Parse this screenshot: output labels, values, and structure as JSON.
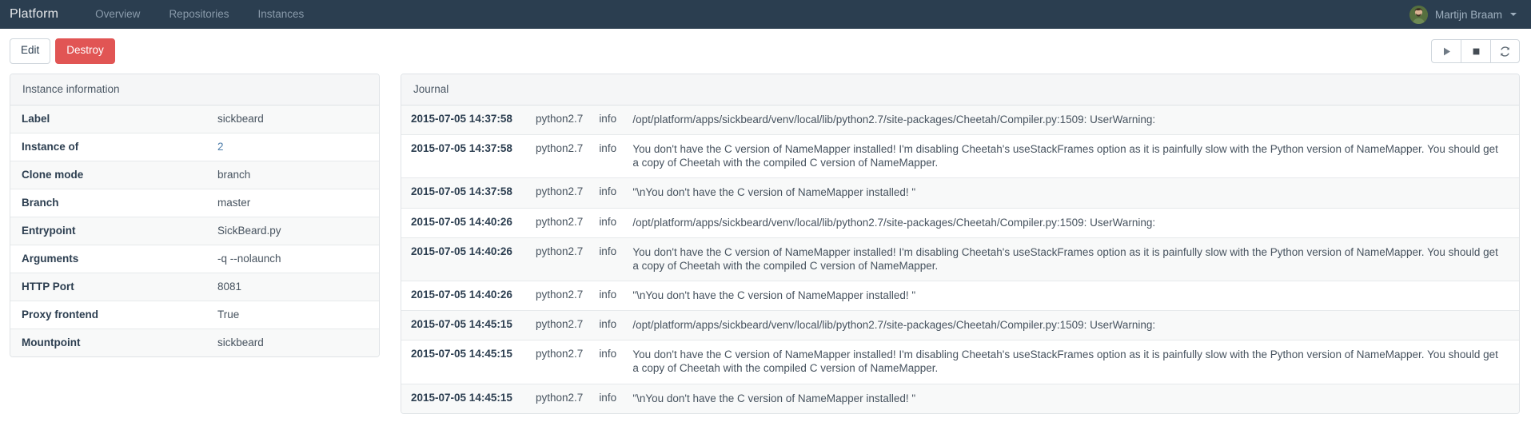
{
  "navbar": {
    "brand": "Platform",
    "links": [
      {
        "label": "Overview"
      },
      {
        "label": "Repositories"
      },
      {
        "label": "Instances"
      }
    ],
    "user": {
      "name": "Martijn Braam",
      "avatar_icon": "user-avatar-photo",
      "caret_icon": "caret-down-icon"
    },
    "background_color": "#2b3e50"
  },
  "toolbar": {
    "edit_label": "Edit",
    "destroy_label": "Destroy",
    "destroy_color": "#e15554",
    "actions": [
      {
        "icon": "play-icon",
        "title": "Start"
      },
      {
        "icon": "stop-icon",
        "title": "Stop"
      },
      {
        "icon": "refresh-icon",
        "title": "Restart"
      }
    ]
  },
  "instance_panel": {
    "title": "Instance information",
    "rows": [
      {
        "key": "Label",
        "value": "sickbeard",
        "link": false
      },
      {
        "key": "Instance of",
        "value": "2",
        "link": true
      },
      {
        "key": "Clone mode",
        "value": "branch",
        "link": false
      },
      {
        "key": "Branch",
        "value": "master",
        "link": false
      },
      {
        "key": "Entrypoint",
        "value": "SickBeard.py",
        "link": false
      },
      {
        "key": "Arguments",
        "value": "-q --nolaunch",
        "link": false
      },
      {
        "key": "HTTP Port",
        "value": "8081",
        "link": false
      },
      {
        "key": "Proxy frontend",
        "value": "True",
        "link": false
      },
      {
        "key": "Mountpoint",
        "value": "sickbeard",
        "link": false
      }
    ]
  },
  "journal_panel": {
    "title": "Journal",
    "entries": [
      {
        "timestamp": "2015-07-05 14:37:58",
        "source": "python2.7",
        "level": "info",
        "message": "/opt/platform/apps/sickbeard/venv/local/lib/python2.7/site-packages/Cheetah/Compiler.py:1509: UserWarning:"
      },
      {
        "timestamp": "2015-07-05 14:37:58",
        "source": "python2.7",
        "level": "info",
        "message": "You don't have the C version of NameMapper installed! I'm disabling Cheetah's useStackFrames option as it is painfully slow with the Python version of NameMapper. You should get a copy of Cheetah with the compiled C version of NameMapper."
      },
      {
        "timestamp": "2015-07-05 14:37:58",
        "source": "python2.7",
        "level": "info",
        "message": "\"\\nYou don't have the C version of NameMapper installed! \""
      },
      {
        "timestamp": "2015-07-05 14:40:26",
        "source": "python2.7",
        "level": "info",
        "message": "/opt/platform/apps/sickbeard/venv/local/lib/python2.7/site-packages/Cheetah/Compiler.py:1509: UserWarning:"
      },
      {
        "timestamp": "2015-07-05 14:40:26",
        "source": "python2.7",
        "level": "info",
        "message": "You don't have the C version of NameMapper installed! I'm disabling Cheetah's useStackFrames option as it is painfully slow with the Python version of NameMapper. You should get a copy of Cheetah with the compiled C version of NameMapper."
      },
      {
        "timestamp": "2015-07-05 14:40:26",
        "source": "python2.7",
        "level": "info",
        "message": "\"\\nYou don't have the C version of NameMapper installed! \""
      },
      {
        "timestamp": "2015-07-05 14:45:15",
        "source": "python2.7",
        "level": "info",
        "message": "/opt/platform/apps/sickbeard/venv/local/lib/python2.7/site-packages/Cheetah/Compiler.py:1509: UserWarning:"
      },
      {
        "timestamp": "2015-07-05 14:45:15",
        "source": "python2.7",
        "level": "info",
        "message": "You don't have the C version of NameMapper installed! I'm disabling Cheetah's useStackFrames option as it is painfully slow with the Python version of NameMapper. You should get a copy of Cheetah with the compiled C version of NameMapper."
      },
      {
        "timestamp": "2015-07-05 14:45:15",
        "source": "python2.7",
        "level": "info",
        "message": "\"\\nYou don't have the C version of NameMapper installed! \""
      }
    ]
  }
}
